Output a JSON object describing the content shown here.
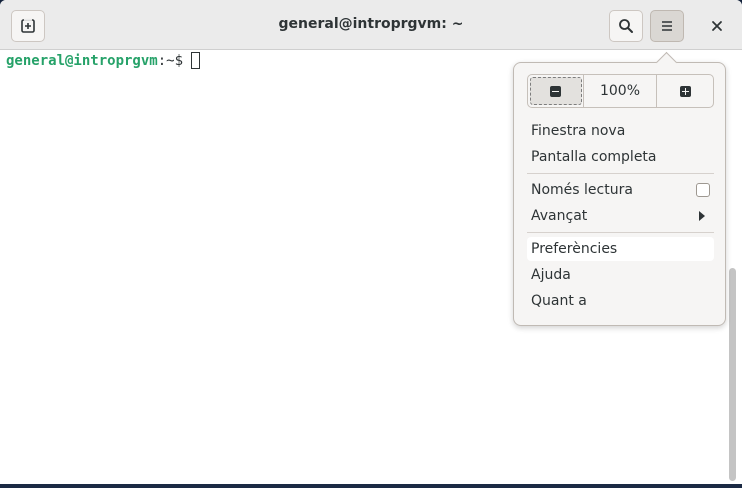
{
  "window": {
    "title": "general@introprgvm: ~"
  },
  "titlebar": {
    "new_tab_icon": "new-tab-icon",
    "search_icon": "search-icon",
    "menu_icon": "hamburger-menu-icon",
    "close_icon": "close-icon"
  },
  "terminal": {
    "prompt_user_host": "general@introprgvm",
    "prompt_colon": ":",
    "prompt_path": "~",
    "prompt_dollar": "$",
    "user_color": "#26a269"
  },
  "menu": {
    "zoom": {
      "decrease_icon": "zoom-out-icon",
      "value": "100%",
      "increase_icon": "zoom-in-icon"
    },
    "items": [
      {
        "label": "Finestra nova"
      },
      {
        "label": "Pantalla completa"
      },
      {
        "label": "Només lectura",
        "checked": false
      },
      {
        "label": "Avançat",
        "submenu": true
      },
      {
        "label": "Preferències",
        "highlighted": true
      },
      {
        "label": "Ajuda"
      },
      {
        "label": "Quant a"
      }
    ]
  }
}
